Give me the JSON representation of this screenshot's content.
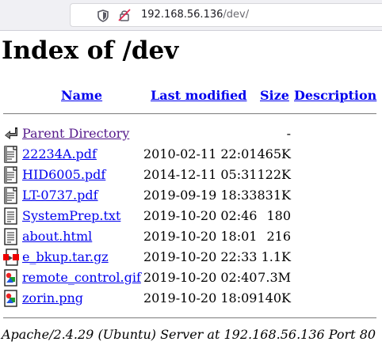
{
  "browser": {
    "url_host": "192.168.56.136",
    "url_path": "/dev/"
  },
  "page": {
    "title": "Index of /dev",
    "columns": {
      "name": "Name",
      "last_modified": "Last modified",
      "size": "Size",
      "description": "Description"
    },
    "parent": {
      "label": "Parent Directory",
      "size": "-"
    },
    "files": [
      {
        "name": "22234A.pdf",
        "modified": "2010-02-11 22:01",
        "size": "465K",
        "icon": "document-icon"
      },
      {
        "name": "HID6005.pdf",
        "modified": "2014-12-11 05:31",
        "size": "122K",
        "icon": "document-icon"
      },
      {
        "name": "LT-0737.pdf",
        "modified": "2019-09-19 18:33",
        "size": "831K",
        "icon": "document-icon"
      },
      {
        "name": "SystemPrep.txt",
        "modified": "2019-10-20 02:46",
        "size": "180",
        "icon": "text-file-icon"
      },
      {
        "name": "about.html",
        "modified": "2019-10-20 18:01",
        "size": "216",
        "icon": "text-file-icon"
      },
      {
        "name": "e_bkup.tar.gz",
        "modified": "2019-10-20 22:33",
        "size": "1.1K",
        "icon": "archive-icon"
      },
      {
        "name": "remote_control.gif",
        "modified": "2019-10-20 02:40",
        "size": "7.3M",
        "icon": "image-icon"
      },
      {
        "name": "zorin.png",
        "modified": "2019-10-20 18:09",
        "size": "140K",
        "icon": "image-icon"
      }
    ],
    "footer": "Apache/2.4.29 (Ubuntu) Server at 192.168.56.136 Port 80"
  }
}
